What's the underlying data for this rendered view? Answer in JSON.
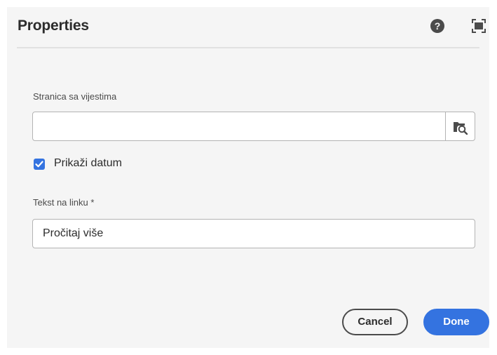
{
  "dialog": {
    "title": "Properties",
    "help_icon": "help-icon",
    "fullscreen_icon": "fullscreen-icon"
  },
  "fields": {
    "news_page": {
      "label": "Stranica sa vijestima",
      "value": "",
      "browse_icon": "folder-search-icon"
    },
    "show_date": {
      "label": "Prikaži datum",
      "checked": true
    },
    "link_text": {
      "label": "Tekst na linku *",
      "value": "Pročitaj više"
    }
  },
  "buttons": {
    "cancel_label": "Cancel",
    "done_label": "Done"
  },
  "colors": {
    "accent": "#3473e0",
    "background": "#f5f5f5",
    "text": "#2c2c2c"
  }
}
